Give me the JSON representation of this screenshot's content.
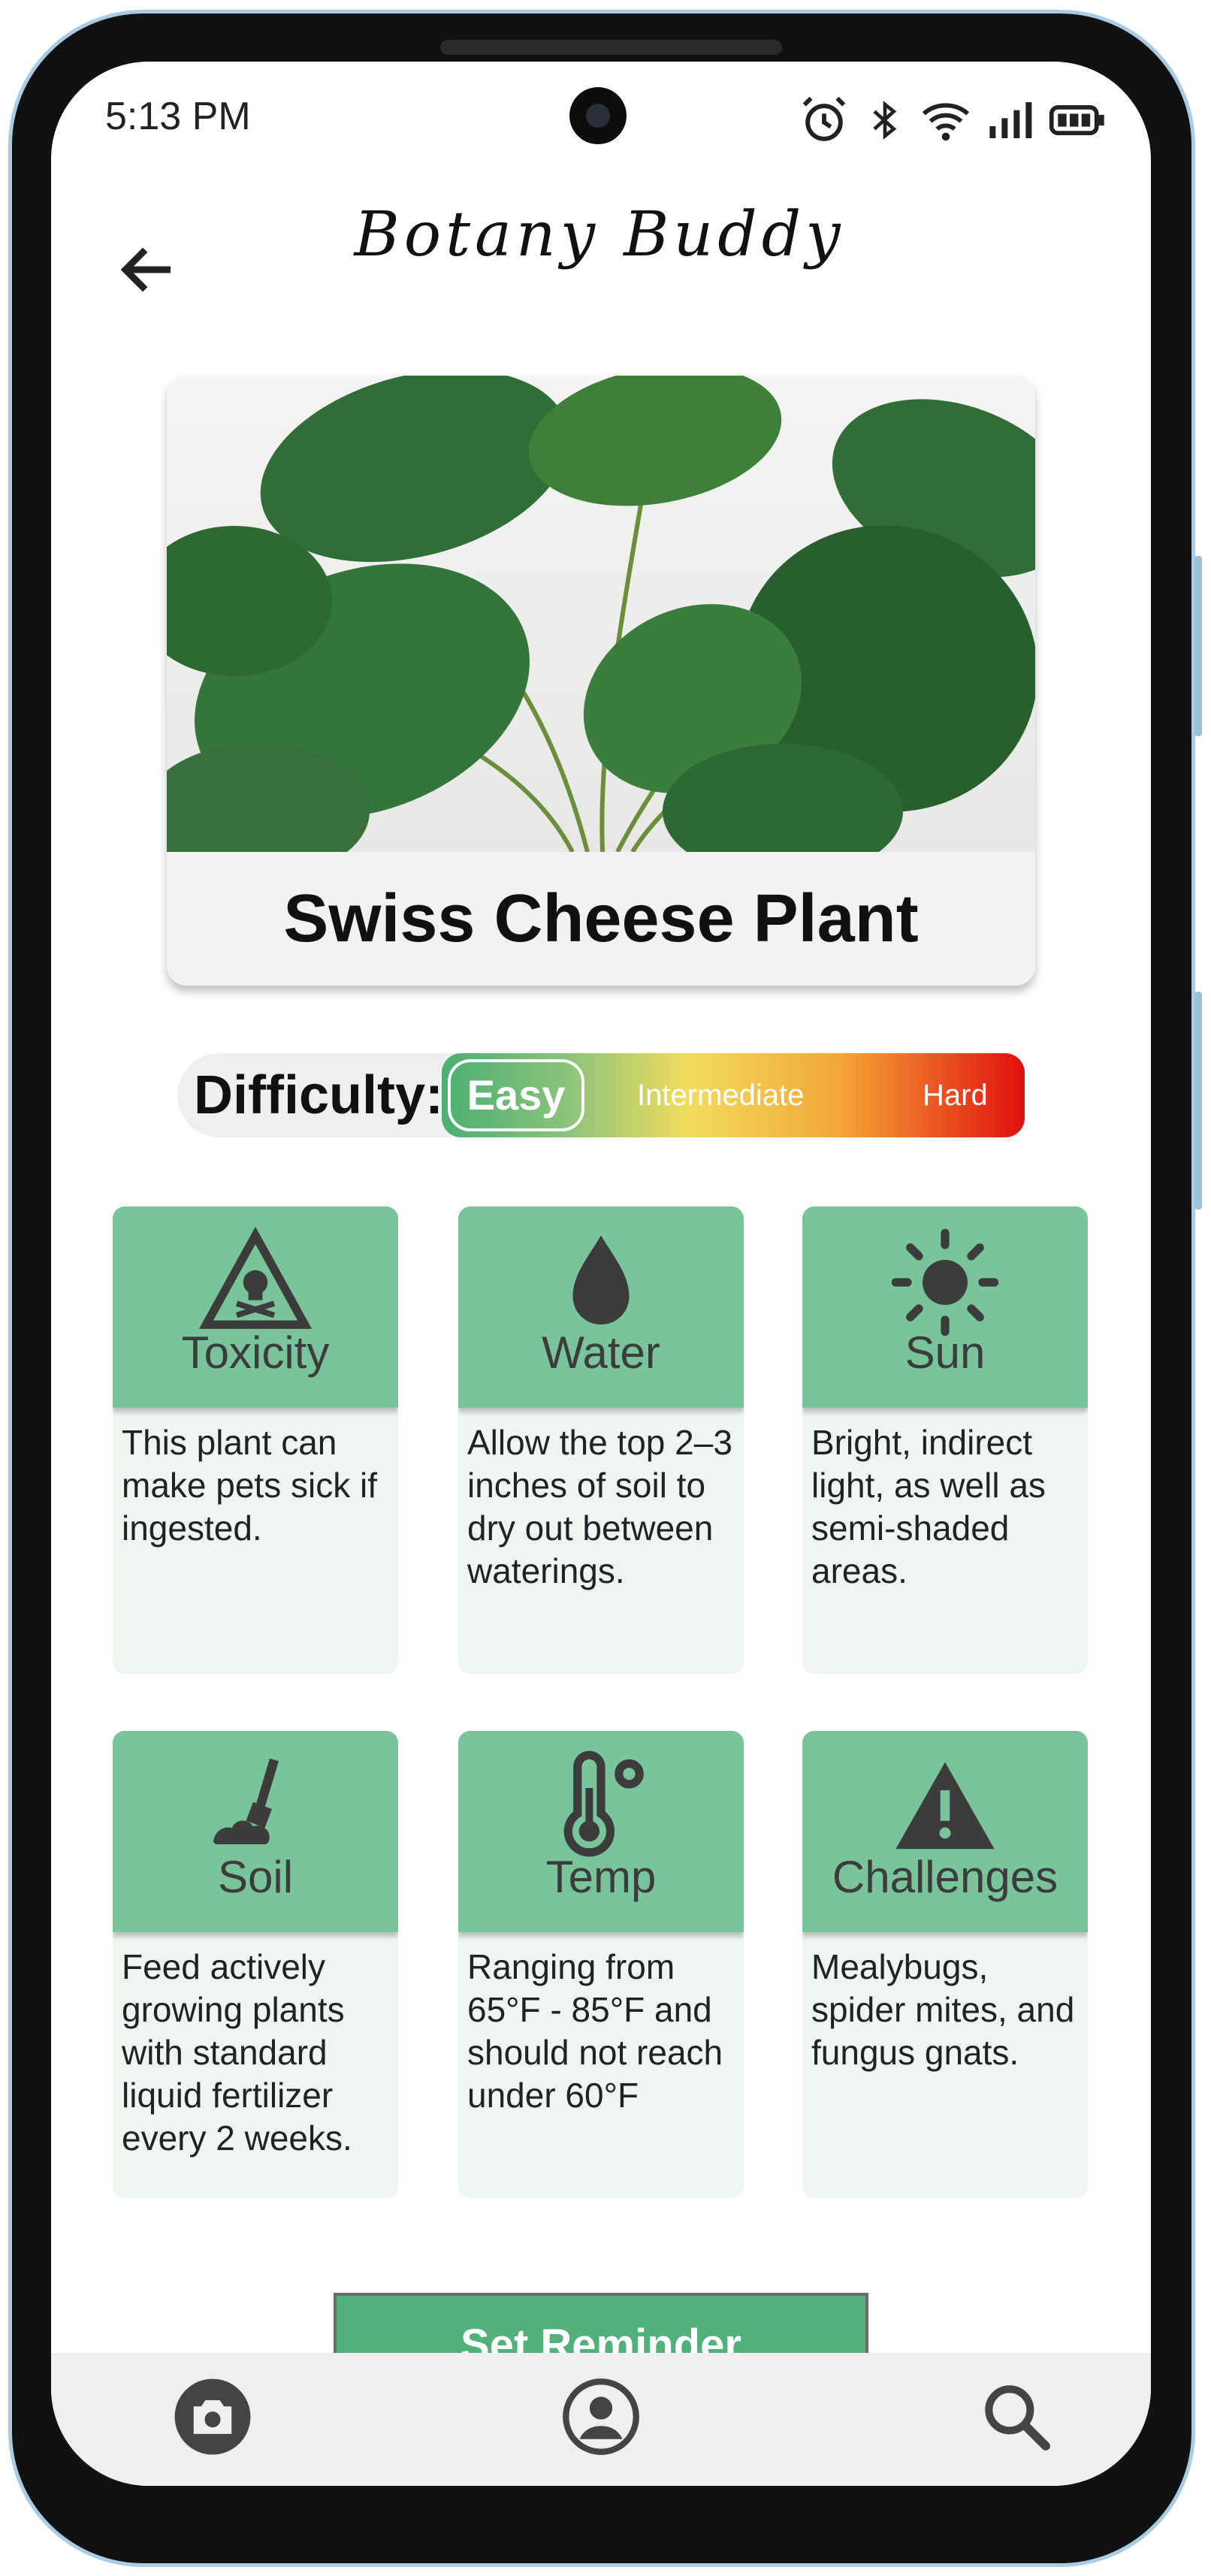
{
  "status_bar": {
    "time": "5:13 PM"
  },
  "app": {
    "title": "Botany Buddy"
  },
  "plant": {
    "name": "Swiss Cheese Plant",
    "image_alt": "Monstera plant leaves"
  },
  "difficulty": {
    "label": "Difficulty:",
    "options": [
      "Easy",
      "Intermediate",
      "Hard"
    ],
    "selected": "Easy"
  },
  "cards": [
    {
      "title": "Toxicity",
      "icon": "toxicity-warning-icon",
      "text": "This plant can make pets sick if ingested."
    },
    {
      "title": "Water",
      "icon": "water-drop-icon",
      "text": " Allow the top 2–3 inches of soil to dry out between waterings."
    },
    {
      "title": "Sun",
      "icon": "sun-icon",
      "text": "Bright, indirect light, as well as semi-shaded areas."
    },
    {
      "title": "Soil",
      "icon": "soil-shovel-icon",
      "text": "Feed actively growing plants with standard liquid fertilizer every 2 weeks."
    },
    {
      "title": "Temp",
      "icon": "thermometer-icon",
      "text": "Ranging from 65°F - 85°F and should not reach under 60°F"
    },
    {
      "title": "Challenges",
      "icon": "alert-triangle-icon",
      "text": "Mealybugs, spider mites, and fungus gnats."
    }
  ],
  "actions": {
    "set_reminder": "Set Reminder"
  },
  "colors": {
    "card_header": "#79c49a",
    "card_body": "#eff6f1",
    "reminder": "#52b07b",
    "easy": "#4caf72",
    "hard": "#e20f0f"
  },
  "nav": [
    {
      "name": "camera",
      "icon": "camera-icon"
    },
    {
      "name": "profile",
      "icon": "profile-icon"
    },
    {
      "name": "search",
      "icon": "search-icon"
    }
  ]
}
